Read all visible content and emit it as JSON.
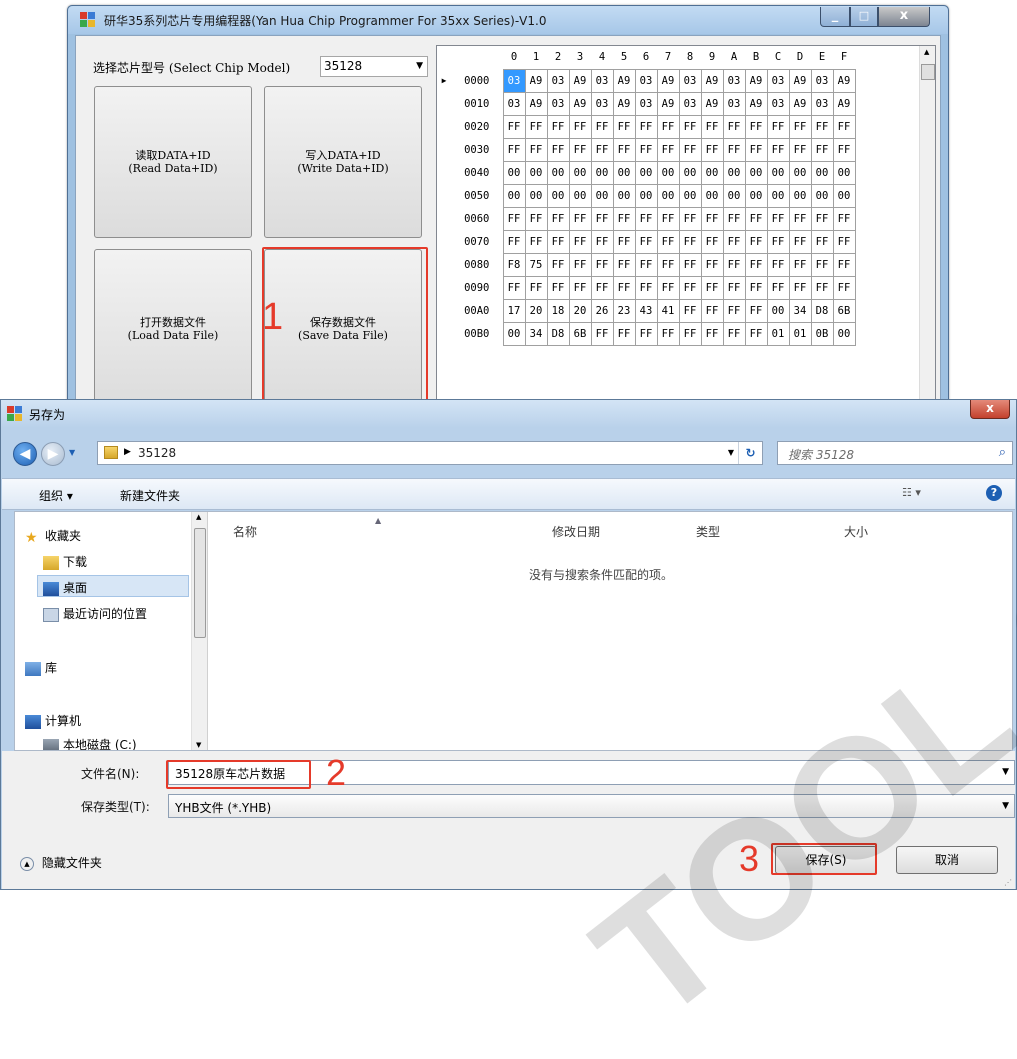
{
  "main_window": {
    "title": "研华35系列芯片专用编程器(Yan Hua Chip Programmer For 35xx Series)-V1.0",
    "minimize": "_",
    "maximize": "□",
    "close": "x",
    "chip_model_label": "选择芯片型号 (Select Chip Model)",
    "chip_model_value": "35128",
    "buttons": {
      "read_cn": "读取DATA+ID",
      "read_en": "(Read Data+ID)",
      "write_cn": "写入DATA+ID",
      "write_en": "(Write Data+ID)",
      "load_cn": "打开数据文件",
      "load_en": "(Load Data File)",
      "save_cn": "保存数据文件",
      "save_en": "(Save Data File)"
    },
    "hex_columns": [
      "0",
      "1",
      "2",
      "3",
      "4",
      "5",
      "6",
      "7",
      "8",
      "9",
      "A",
      "B",
      "C",
      "D",
      "E",
      "F"
    ],
    "hex_rows": [
      {
        "addr": "0000",
        "cells": [
          "03",
          "A9",
          "03",
          "A9",
          "03",
          "A9",
          "03",
          "A9",
          "03",
          "A9",
          "03",
          "A9",
          "03",
          "A9",
          "03",
          "A9"
        ]
      },
      {
        "addr": "0010",
        "cells": [
          "03",
          "A9",
          "03",
          "A9",
          "03",
          "A9",
          "03",
          "A9",
          "03",
          "A9",
          "03",
          "A9",
          "03",
          "A9",
          "03",
          "A9"
        ]
      },
      {
        "addr": "0020",
        "cells": [
          "FF",
          "FF",
          "FF",
          "FF",
          "FF",
          "FF",
          "FF",
          "FF",
          "FF",
          "FF",
          "FF",
          "FF",
          "FF",
          "FF",
          "FF",
          "FF"
        ]
      },
      {
        "addr": "0030",
        "cells": [
          "FF",
          "FF",
          "FF",
          "FF",
          "FF",
          "FF",
          "FF",
          "FF",
          "FF",
          "FF",
          "FF",
          "FF",
          "FF",
          "FF",
          "FF",
          "FF"
        ]
      },
      {
        "addr": "0040",
        "cells": [
          "00",
          "00",
          "00",
          "00",
          "00",
          "00",
          "00",
          "00",
          "00",
          "00",
          "00",
          "00",
          "00",
          "00",
          "00",
          "00"
        ]
      },
      {
        "addr": "0050",
        "cells": [
          "00",
          "00",
          "00",
          "00",
          "00",
          "00",
          "00",
          "00",
          "00",
          "00",
          "00",
          "00",
          "00",
          "00",
          "00",
          "00"
        ]
      },
      {
        "addr": "0060",
        "cells": [
          "FF",
          "FF",
          "FF",
          "FF",
          "FF",
          "FF",
          "FF",
          "FF",
          "FF",
          "FF",
          "FF",
          "FF",
          "FF",
          "FF",
          "FF",
          "FF"
        ]
      },
      {
        "addr": "0070",
        "cells": [
          "FF",
          "FF",
          "FF",
          "FF",
          "FF",
          "FF",
          "FF",
          "FF",
          "FF",
          "FF",
          "FF",
          "FF",
          "FF",
          "FF",
          "FF",
          "FF"
        ]
      },
      {
        "addr": "0080",
        "cells": [
          "F8",
          "75",
          "FF",
          "FF",
          "FF",
          "FF",
          "FF",
          "FF",
          "FF",
          "FF",
          "FF",
          "FF",
          "FF",
          "FF",
          "FF",
          "FF"
        ]
      },
      {
        "addr": "0090",
        "cells": [
          "FF",
          "FF",
          "FF",
          "FF",
          "FF",
          "FF",
          "FF",
          "FF",
          "FF",
          "FF",
          "FF",
          "FF",
          "FF",
          "FF",
          "FF",
          "FF"
        ]
      },
      {
        "addr": "00A0",
        "cells": [
          "17",
          "20",
          "18",
          "20",
          "26",
          "23",
          "43",
          "41",
          "FF",
          "FF",
          "FF",
          "FF",
          "00",
          "34",
          "D8",
          "6B"
        ]
      },
      {
        "addr": "00B0",
        "cells": [
          "00",
          "34",
          "D8",
          "6B",
          "FF",
          "FF",
          "FF",
          "FF",
          "FF",
          "FF",
          "FF",
          "FF",
          "01",
          "01",
          "0B",
          "00"
        ]
      }
    ]
  },
  "dialog": {
    "title": "另存为",
    "close": "x",
    "path": "35128",
    "search_placeholder": "搜索 35128",
    "organize": "组织 ▾",
    "new_folder": "新建文件夹",
    "nav_items": {
      "favorites": "收藏夹",
      "downloads": "下载",
      "desktop": "桌面",
      "recent": "最近访问的位置",
      "libraries": "库",
      "computer": "计算机",
      "local_disk": "本地磁盘 (C:)"
    },
    "columns": {
      "name": "名称",
      "modified": "修改日期",
      "type": "类型",
      "size": "大小"
    },
    "empty_message": "没有与搜索条件匹配的项。",
    "filename_label": "文件名(N):",
    "filename_value": "35128原车芯片数据",
    "filetype_label": "保存类型(T):",
    "filetype_value": "YHB文件 (*.YHB)",
    "hide_folders": "隐藏文件夹",
    "save_button": "保存(S)",
    "cancel_button": "取消"
  },
  "annotations": {
    "step1": "1",
    "step2": "2",
    "step3": "3",
    "highlight_color": "#e53a2a"
  },
  "watermark": "TOOL.CO."
}
